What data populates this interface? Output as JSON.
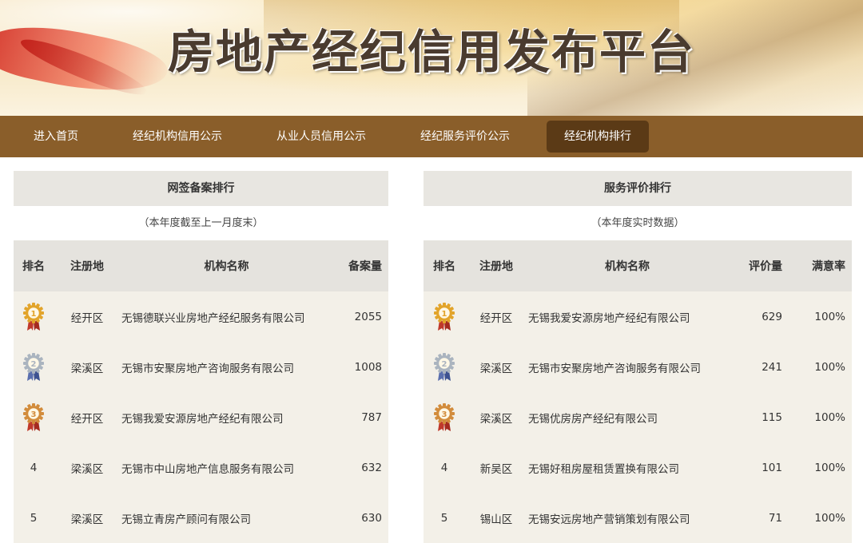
{
  "banner": {
    "title": "房地产经纪信用发布平台"
  },
  "nav": {
    "items": [
      {
        "label": "进入首页",
        "active": false
      },
      {
        "label": "经纪机构信用公示",
        "active": false
      },
      {
        "label": "从业人员信用公示",
        "active": false
      },
      {
        "label": "经纪服务评价公示",
        "active": false
      },
      {
        "label": "经纪机构排行",
        "active": true
      }
    ]
  },
  "left_panel": {
    "title": "网签备案排行",
    "subtitle": "（本年度截至上一月度末）",
    "headers": [
      "排名",
      "注册地",
      "机构名称",
      "备案量"
    ],
    "rows": [
      {
        "rank": "1",
        "medal": "gold",
        "district": "经开区",
        "name": "无锡德联兴业房地产经纪服务有限公司",
        "count": "2055"
      },
      {
        "rank": "2",
        "medal": "silver",
        "district": "梁溪区",
        "name": "无锡市安聚房地产咨询服务有限公司",
        "count": "1008"
      },
      {
        "rank": "3",
        "medal": "bronze",
        "district": "经开区",
        "name": "无锡我爱安源房地产经纪有限公司",
        "count": "787"
      },
      {
        "rank": "4",
        "medal": "",
        "district": "梁溪区",
        "name": "无锡市中山房地产信息服务有限公司",
        "count": "632"
      },
      {
        "rank": "5",
        "medal": "",
        "district": "梁溪区",
        "name": "无锡立青房产顾问有限公司",
        "count": "630"
      }
    ]
  },
  "right_panel": {
    "title": "服务评价排行",
    "subtitle": "（本年度实时数据）",
    "headers": [
      "排名",
      "注册地",
      "机构名称",
      "评价量",
      "满意率"
    ],
    "rows": [
      {
        "rank": "1",
        "medal": "gold",
        "district": "经开区",
        "name": "无锡我爱安源房地产经纪有限公司",
        "count": "629",
        "rate": "100%"
      },
      {
        "rank": "2",
        "medal": "silver",
        "district": "梁溪区",
        "name": "无锡市安聚房地产咨询服务有限公司",
        "count": "241",
        "rate": "100%"
      },
      {
        "rank": "3",
        "medal": "bronze",
        "district": "梁溪区",
        "name": "无锡优房房产经纪有限公司",
        "count": "115",
        "rate": "100%"
      },
      {
        "rank": "4",
        "medal": "",
        "district": "新吴区",
        "name": "无锡好租房屋租赁置换有限公司",
        "count": "101",
        "rate": "100%"
      },
      {
        "rank": "5",
        "medal": "",
        "district": "锡山区",
        "name": "无锡安远房地产营销策划有限公司",
        "count": "71",
        "rate": "100%"
      }
    ]
  },
  "medal_colors": {
    "gold": "#e2a42b",
    "silver": "#aab4bf",
    "bronze": "#d28c3c"
  }
}
